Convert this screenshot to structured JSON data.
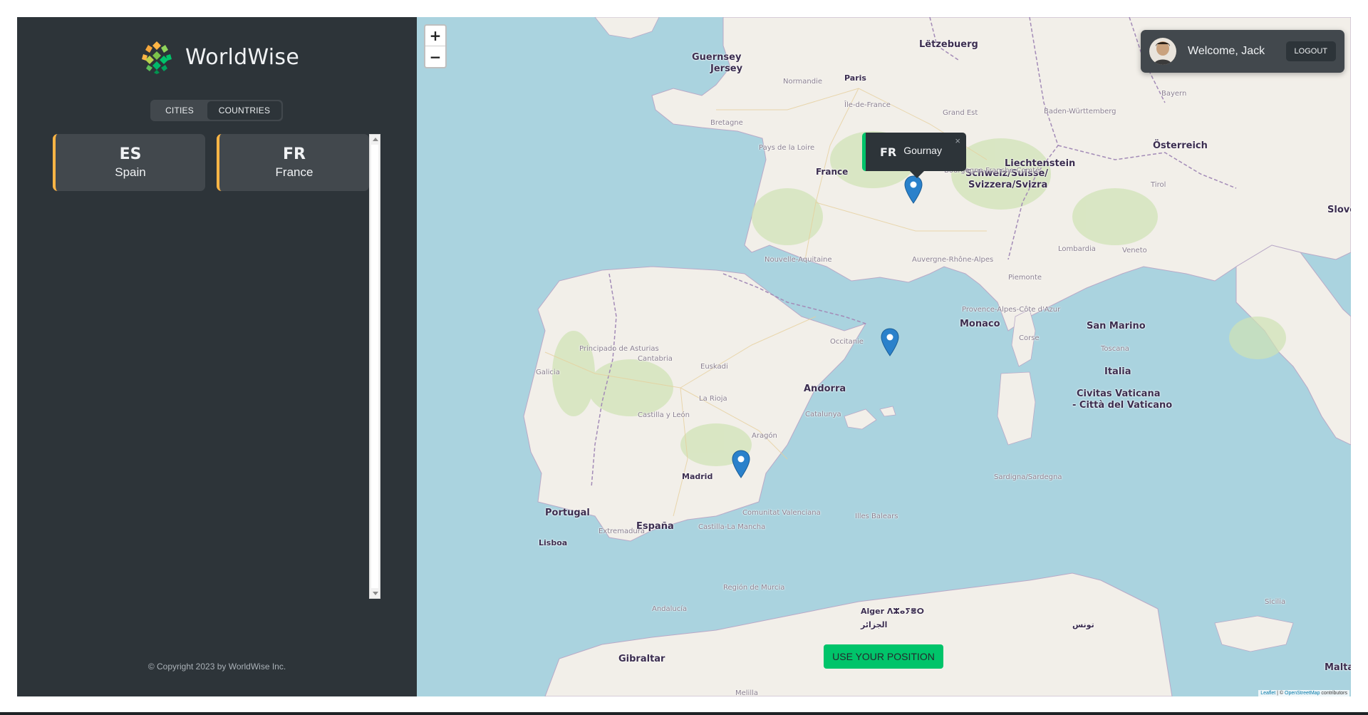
{
  "sidebar": {
    "app_name": "WorldWise",
    "tabs": [
      {
        "label": "CITIES",
        "active": false
      },
      {
        "label": "COUNTRIES",
        "active": true
      }
    ],
    "countries": [
      {
        "code": "ES",
        "name": "Spain"
      },
      {
        "code": "FR",
        "name": "France"
      }
    ],
    "copyright": "© Copyright 2023 by WorldWise Inc."
  },
  "map": {
    "zoom_in": "+",
    "zoom_out": "−",
    "user": {
      "greeting": "Welcome, Jack",
      "logout_label": "LOGOUT"
    },
    "popup": {
      "code": "FR",
      "city": "Gournay",
      "close": "×"
    },
    "use_position_label": "USE YOUR POSITION",
    "attribution": {
      "leaflet": "Leaflet",
      "sep": "| ©",
      "osm": "OpenStreetMap",
      "suffix": "contributors"
    },
    "labels": {
      "guernsey": "Guernsey",
      "jersey": "Jersey",
      "paris": "Paris",
      "letzebuerg": "Lëtzebuerg",
      "france": "France",
      "liechtenstein": "Liechtenstein",
      "schweiz": "Schweiz/Suisse/",
      "svizzera": "Svizzera/Svizra",
      "osterreich": "Österreich",
      "slovenija": "Sloveni",
      "monaco": "Monaco",
      "san_marino": "San Marino",
      "italia": "Italia",
      "vaticana_1": "Civitas Vaticana",
      "vaticana_2": "- Città del Vaticano",
      "andorra": "Andorra",
      "madrid": "Madrid",
      "portugal": "Portugal",
      "espana": "España",
      "lisboa": "Lisboa",
      "gibraltar": "Gibraltar",
      "alger": "Alger ⴷⵣⴰⵢⴻⵔ",
      "alger_ar": "الجزائر",
      "tunis": "تونس",
      "malta": "Malta",
      "bretagne": "Bretagne",
      "normandie": "Normandie",
      "pays_loire": "Pays de la Loire",
      "nouvelle_aquitaine": "Nouvelle-Aquitaine",
      "occitanie": "Occitanie",
      "auvergne": "Auvergne-Rhône-Alpes",
      "bourgogne": "Bourgogne-Franche-Comté",
      "grand_est": "Grand Est",
      "ile_de_france": "Île-de-France",
      "provence": "Provence-Alpes-Côte d'Azur",
      "galicia": "Galicia",
      "asturias": "Principado de Asturias",
      "cantabria": "Cantabria",
      "euskadi": "Euskadi",
      "la_rioja": "La Rioja",
      "aragon": "Aragón",
      "catalunya": "Catalunya",
      "castilla_leon": "Castilla y León",
      "extremadura": "Extremadura",
      "castilla_mancha": "Castilla-La Mancha",
      "valenciana": "Comunitat Valenciana",
      "murcia": "Región de Murcia",
      "andalucia": "Andalucía",
      "illes_balears": "Illes Balears",
      "corse": "Corse",
      "sardegna": "Sardigna/Sardegna",
      "sicilia": "Sicilia",
      "toscana": "Toscana",
      "lombardia": "Lombardia",
      "veneto": "Veneto",
      "piemonte": "Piemonte",
      "bayern": "Bayern",
      "baden": "Baden-Württemberg",
      "tirol": "Tirol",
      "melilla": "Melilla"
    }
  },
  "colors": {
    "sidebar_bg": "#2d3439",
    "card_bg": "#42484d",
    "accent_orange": "#ffb545",
    "accent_green": "#00c46a",
    "sea": "#aad3df",
    "land": "#f2efe9",
    "marker_blue": "#2a81cb"
  },
  "icons": {
    "logo": "worldwise-logo-icon",
    "marker": "map-marker-icon",
    "avatar": "user-avatar-icon"
  }
}
